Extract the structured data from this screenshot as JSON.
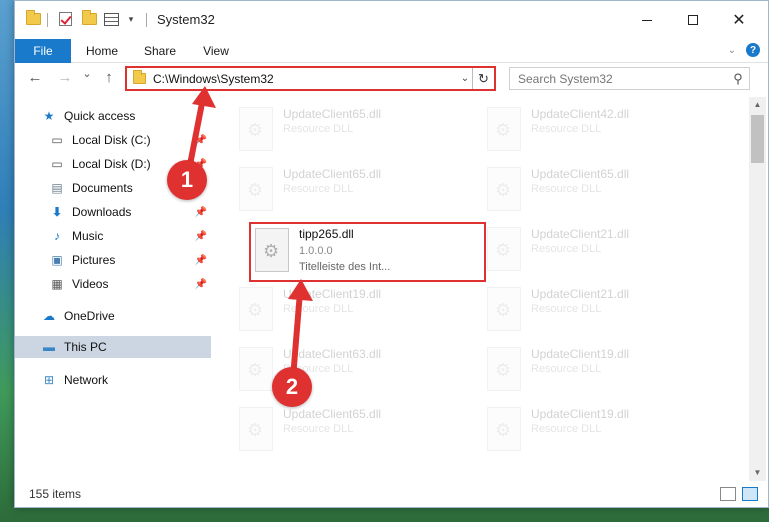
{
  "window": {
    "title": "System32",
    "minimize_label": "",
    "close_label": "✕"
  },
  "ribbon": {
    "tabs": [
      "File",
      "Home",
      "Share",
      "View"
    ],
    "help_label": "?"
  },
  "address": {
    "path": "C:\\Windows\\System32",
    "dropdown_glyph": "⌄",
    "refresh_glyph": "↻"
  },
  "search": {
    "placeholder": "Search System32"
  },
  "nav_buttons": {
    "back": "←",
    "forward": "→",
    "recent": "⌄",
    "up": "↑"
  },
  "sidebar": {
    "items": [
      {
        "label": "Quick access",
        "icon": "star-icon",
        "pinned": false
      },
      {
        "label": "Local Disk (C:)",
        "icon": "drive-icon",
        "pinned": true
      },
      {
        "label": "Local Disk (D:)",
        "icon": "drive-icon",
        "pinned": true
      },
      {
        "label": "Documents",
        "icon": "documents-icon",
        "pinned": true
      },
      {
        "label": "Downloads",
        "icon": "download-icon",
        "pinned": true
      },
      {
        "label": "Music",
        "icon": "music-icon",
        "pinned": true
      },
      {
        "label": "Pictures",
        "icon": "pictures-icon",
        "pinned": true
      },
      {
        "label": "Videos",
        "icon": "videos-icon",
        "pinned": true
      },
      {
        "label": "OneDrive",
        "icon": "cloud-icon",
        "pinned": false
      },
      {
        "label": "This PC",
        "icon": "computer-icon",
        "pinned": false,
        "selected": true
      },
      {
        "label": "Network",
        "icon": "network-icon",
        "pinned": false
      }
    ]
  },
  "files": {
    "left": [
      {
        "name": "UpdateClient65.dll",
        "type": "Resource DLL"
      },
      {
        "name": "UpdateClient65.dll",
        "type": "Resource DLL"
      },
      {
        "name": "tipp265.dll",
        "version": "1.0.0.0",
        "description": "Titelleiste des Int..."
      },
      {
        "name": "UpdateClient19.dll",
        "type": "Resource DLL"
      },
      {
        "name": "UpdateClient63.dll",
        "type": "Resource DLL"
      },
      {
        "name": "UpdateClient65.dll",
        "type": "Resource DLL"
      }
    ],
    "right": [
      {
        "name": "UpdateClient42.dll",
        "type": "Resource DLL"
      },
      {
        "name": "UpdateClient65.dll",
        "type": "Resource DLL"
      },
      {
        "name": "UpdateClient21.dll",
        "type": "Resource DLL"
      },
      {
        "name": "UpdateClient21.dll",
        "type": "Resource DLL"
      },
      {
        "name": "UpdateClient19.dll",
        "type": "Resource DLL"
      },
      {
        "name": "UpdateClient19.dll",
        "type": "Resource DLL"
      }
    ]
  },
  "status": {
    "item_count": "155 items"
  },
  "annotations": {
    "badge1": "1",
    "badge2": "2",
    "color": "#e03131"
  },
  "colors": {
    "accent": "#1979ca",
    "highlight": "#e03131",
    "selected_nav": "#ccd6e2"
  }
}
